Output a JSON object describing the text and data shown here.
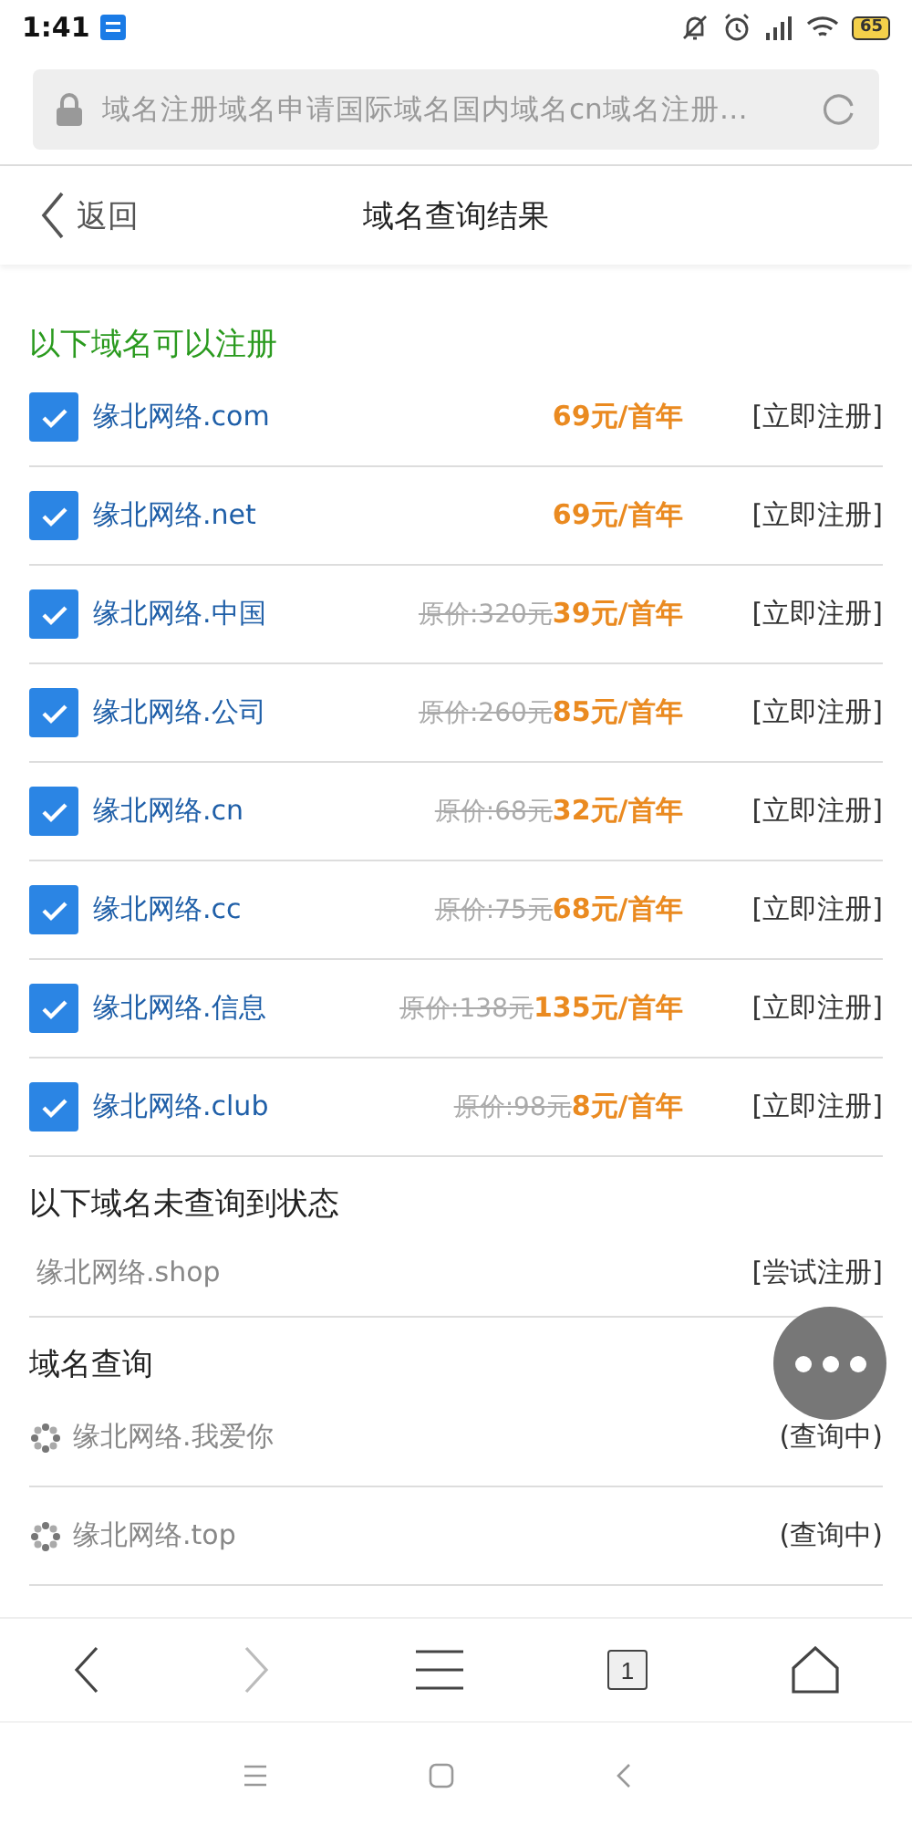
{
  "status_bar": {
    "time": "1:41",
    "battery": "65"
  },
  "address_bar": {
    "title": "域名注册域名申请国际域名国内域名cn域名注册…"
  },
  "header": {
    "back": "返回",
    "title": "域名查询结果"
  },
  "available": {
    "title": "以下域名可以注册",
    "items": [
      {
        "name": "缘北网络.com",
        "checked": true,
        "price": "69元/首年",
        "action": "[立即注册]"
      },
      {
        "name": "缘北网络.net",
        "checked": true,
        "price": "69元/首年",
        "action": "[立即注册]"
      },
      {
        "name": "缘北网络.中国",
        "checked": true,
        "original_price": "原价:320元",
        "price": "39元/首年",
        "action": "[立即注册]"
      },
      {
        "name": "缘北网络.公司",
        "checked": true,
        "original_price": "原价:260元",
        "price": "85元/首年",
        "action": "[立即注册]"
      },
      {
        "name": "缘北网络.cn",
        "checked": true,
        "original_price": "原价:68元",
        "price": "32元/首年",
        "action": "[立即注册]"
      },
      {
        "name": "缘北网络.cc",
        "checked": true,
        "original_price": "原价:75元",
        "price": "68元/首年",
        "action": "[立即注册]"
      },
      {
        "name": "缘北网络.信息",
        "checked": true,
        "original_price": "原价:138元",
        "price": "135元/首年",
        "action": "[立即注册]"
      },
      {
        "name": "缘北网络.club",
        "checked": true,
        "original_price": "原价:98元",
        "price": "8元/首年",
        "action": "[立即注册]"
      }
    ]
  },
  "unknown": {
    "title": "以下域名未查询到状态",
    "items": [
      {
        "name": "缘北网络.shop",
        "action": "[尝试注册]"
      }
    ]
  },
  "querying": {
    "title": "域名查询",
    "items": [
      {
        "name": "缘北网络.我爱你",
        "status": "(查询中)"
      },
      {
        "name": "缘北网络.top",
        "status": "(查询中)"
      }
    ]
  },
  "toolbar": [
    {
      "kind": "back",
      "disabled": false
    },
    {
      "kind": "forward",
      "disabled": true
    },
    {
      "kind": "menu",
      "disabled": false
    },
    {
      "kind": "tabs",
      "label": "1",
      "disabled": false
    },
    {
      "kind": "home",
      "disabled": false
    }
  ],
  "system_nav": [
    {
      "kind": "menu"
    },
    {
      "kind": "home"
    },
    {
      "kind": "back"
    }
  ]
}
